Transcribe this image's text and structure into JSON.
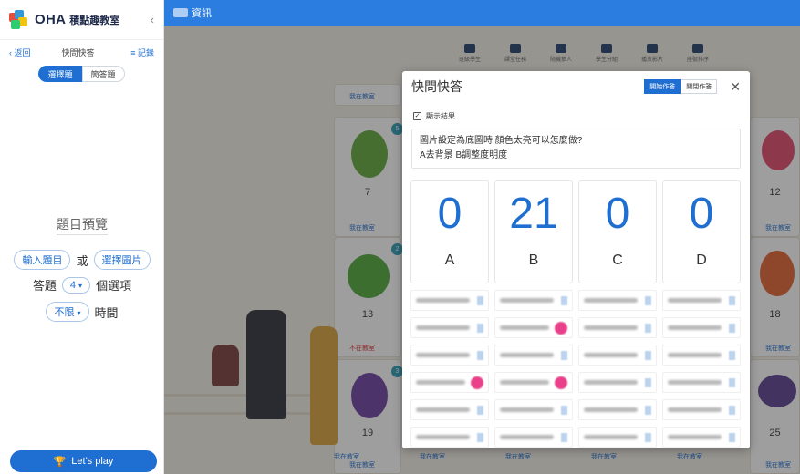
{
  "sidebar": {
    "logo_text": "OHA",
    "logo_sub": "積點趣教室",
    "collapse": "‹",
    "nav": {
      "back": "‹ 返回",
      "title": "快問快答",
      "record": "≡ 記錄"
    },
    "segments": [
      "選擇題",
      "簡答題"
    ],
    "preview": "題目預覽",
    "input_question": "輸入題目",
    "or": "或",
    "choose_image": "選擇圖片",
    "answer_label": "答題",
    "option_count": "4",
    "option_suffix": "個選項",
    "time_value": "不限",
    "time_label": "時間",
    "play_label": "Let's play"
  },
  "topbar": {
    "title": "資訊"
  },
  "toolbar": [
    {
      "icon": "class-icon",
      "label": "班級學生"
    },
    {
      "icon": "task-icon",
      "label": "課堂任務"
    },
    {
      "icon": "random-icon",
      "label": "隨機抽人"
    },
    {
      "icon": "group-icon",
      "label": "學生分組"
    },
    {
      "icon": "video-icon",
      "label": "播放影片"
    },
    {
      "icon": "calendar-icon",
      "label": "座號排序"
    }
  ],
  "classroom": {
    "cards": [
      {
        "num": "",
        "foot": "我在教室",
        "status": "present"
      },
      {
        "num": "7",
        "foot": "我在教室",
        "status": "present"
      },
      {
        "num": "13",
        "foot": "不在教室",
        "status": "absent"
      },
      {
        "num": "19",
        "foot": "我在教室",
        "status": "present"
      },
      {
        "num": "12",
        "foot": "我在教室",
        "status": "present"
      },
      {
        "num": "18",
        "foot": "我在教室",
        "status": "present"
      },
      {
        "num": "25",
        "foot": "我在教室",
        "status": "present"
      }
    ],
    "badges": [
      "5",
      "2",
      "3"
    ],
    "bottom_feet": [
      "我在教室",
      "我在教室",
      "我在教室",
      "我在教室",
      "我在教室"
    ]
  },
  "modal": {
    "title": "快問快答",
    "btn_start": "開始作答",
    "btn_stop": "關閉作答",
    "close": "✕",
    "show_result": "顯示結果",
    "question_line1": "圖片設定為底圖時,顏色太亮可以怎麼做?",
    "question_line2": "A去背景 B調整度明度",
    "results": [
      {
        "letter": "A",
        "count": "0"
      },
      {
        "letter": "B",
        "count": "21"
      },
      {
        "letter": "C",
        "count": "0"
      },
      {
        "letter": "D",
        "count": "0"
      }
    ]
  },
  "colors": {
    "primary": "#1f6fd2",
    "topbar": "#2b7de0",
    "pink": "#e9408a"
  }
}
